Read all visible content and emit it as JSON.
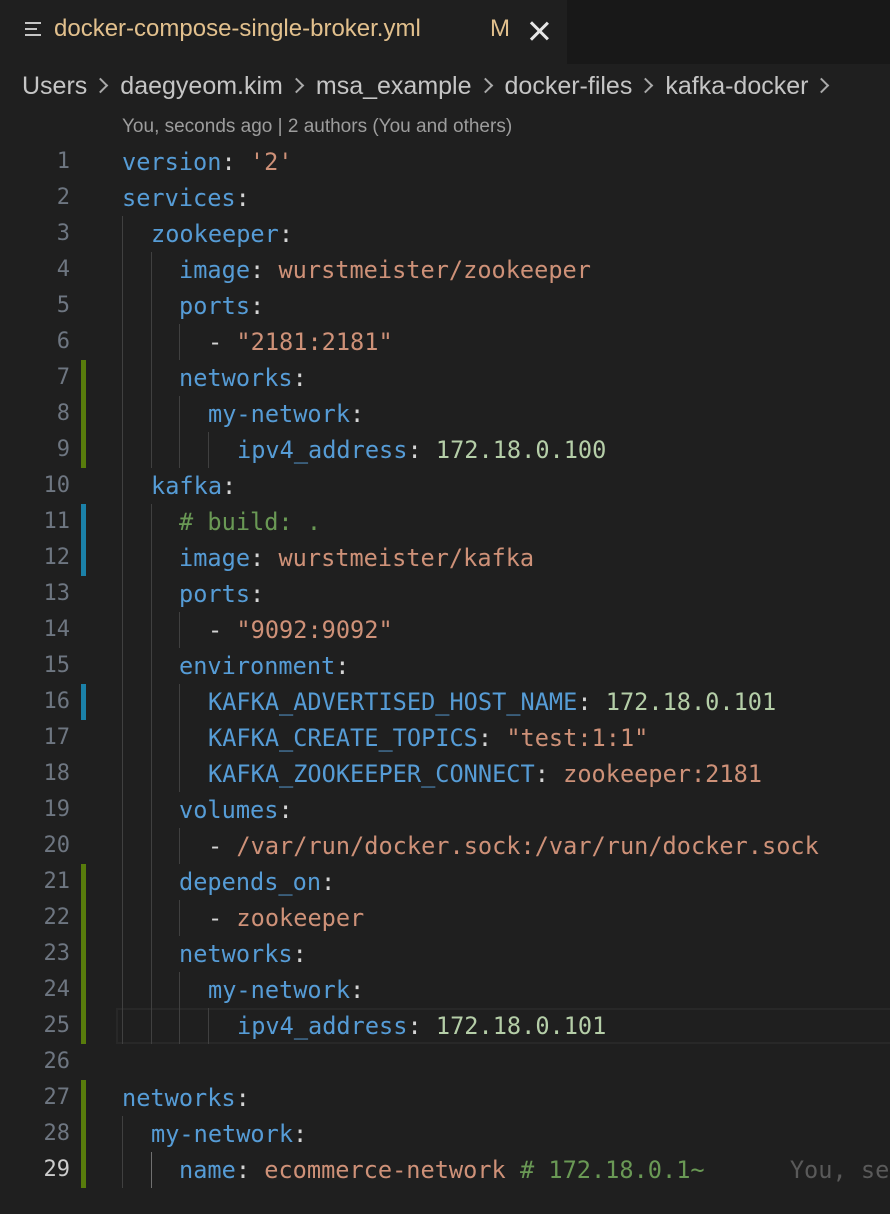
{
  "tab": {
    "file_name": "docker-compose-single-broker.yml",
    "badge": "M",
    "icon": "file-lines-icon"
  },
  "breadcrumb": [
    "Users",
    "daegyeom.kim",
    "msa_example",
    "docker-files",
    "kafka-docker"
  ],
  "blame": "You, seconds ago | 2 authors (You and others)",
  "lines": [
    {
      "n": "1",
      "indent": 0,
      "tokens": [
        {
          "t": "k",
          "v": "version"
        },
        {
          "t": "p",
          "v": ": "
        },
        {
          "t": "s",
          "v": "'2'"
        }
      ]
    },
    {
      "n": "2",
      "indent": 0,
      "tokens": [
        {
          "t": "k",
          "v": "services"
        },
        {
          "t": "p",
          "v": ":"
        }
      ]
    },
    {
      "n": "3",
      "indent": 1,
      "tokens": [
        {
          "t": "k",
          "v": "zookeeper"
        },
        {
          "t": "p",
          "v": ":"
        }
      ]
    },
    {
      "n": "4",
      "indent": 2,
      "tokens": [
        {
          "t": "k",
          "v": "image"
        },
        {
          "t": "p",
          "v": ": "
        },
        {
          "t": "s",
          "v": "wurstmeister/zookeeper"
        }
      ]
    },
    {
      "n": "5",
      "indent": 2,
      "tokens": [
        {
          "t": "k",
          "v": "ports"
        },
        {
          "t": "p",
          "v": ":"
        }
      ]
    },
    {
      "n": "6",
      "indent": 3,
      "tokens": [
        {
          "t": "p",
          "v": "- "
        },
        {
          "t": "s",
          "v": "\"2181:2181\""
        }
      ]
    },
    {
      "n": "7",
      "indent": 2,
      "tokens": [
        {
          "t": "k",
          "v": "networks"
        },
        {
          "t": "p",
          "v": ":"
        }
      ]
    },
    {
      "n": "8",
      "indent": 3,
      "tokens": [
        {
          "t": "k",
          "v": "my-network"
        },
        {
          "t": "p",
          "v": ":"
        }
      ]
    },
    {
      "n": "9",
      "indent": 4,
      "tokens": [
        {
          "t": "k",
          "v": "ipv4_address"
        },
        {
          "t": "p",
          "v": ": "
        },
        {
          "t": "n",
          "v": "172.18.0.100"
        }
      ]
    },
    {
      "n": "10",
      "indent": 1,
      "tokens": [
        {
          "t": "k",
          "v": "kafka"
        },
        {
          "t": "p",
          "v": ":"
        }
      ]
    },
    {
      "n": "11",
      "indent": 2,
      "tokens": [
        {
          "t": "c",
          "v": "# build: ."
        }
      ]
    },
    {
      "n": "12",
      "indent": 2,
      "tokens": [
        {
          "t": "k",
          "v": "image"
        },
        {
          "t": "p",
          "v": ": "
        },
        {
          "t": "s",
          "v": "wurstmeister/kafka"
        }
      ]
    },
    {
      "n": "13",
      "indent": 2,
      "tokens": [
        {
          "t": "k",
          "v": "ports"
        },
        {
          "t": "p",
          "v": ":"
        }
      ]
    },
    {
      "n": "14",
      "indent": 3,
      "tokens": [
        {
          "t": "p",
          "v": "- "
        },
        {
          "t": "s",
          "v": "\"9092:9092\""
        }
      ]
    },
    {
      "n": "15",
      "indent": 2,
      "tokens": [
        {
          "t": "k",
          "v": "environment"
        },
        {
          "t": "p",
          "v": ":"
        }
      ]
    },
    {
      "n": "16",
      "indent": 3,
      "tokens": [
        {
          "t": "k",
          "v": "KAFKA_ADVERTISED_HOST_NAME"
        },
        {
          "t": "p",
          "v": ": "
        },
        {
          "t": "n",
          "v": "172.18.0.101"
        }
      ]
    },
    {
      "n": "17",
      "indent": 3,
      "tokens": [
        {
          "t": "k",
          "v": "KAFKA_CREATE_TOPICS"
        },
        {
          "t": "p",
          "v": ": "
        },
        {
          "t": "s",
          "v": "\"test:1:1\""
        }
      ]
    },
    {
      "n": "18",
      "indent": 3,
      "tokens": [
        {
          "t": "k",
          "v": "KAFKA_ZOOKEEPER_CONNECT"
        },
        {
          "t": "p",
          "v": ": "
        },
        {
          "t": "s",
          "v": "zookeeper:2181"
        }
      ]
    },
    {
      "n": "19",
      "indent": 2,
      "tokens": [
        {
          "t": "k",
          "v": "volumes"
        },
        {
          "t": "p",
          "v": ":"
        }
      ]
    },
    {
      "n": "20",
      "indent": 3,
      "tokens": [
        {
          "t": "p",
          "v": "- "
        },
        {
          "t": "s",
          "v": "/var/run/docker.sock:/var/run/docker.sock"
        }
      ]
    },
    {
      "n": "21",
      "indent": 2,
      "tokens": [
        {
          "t": "k",
          "v": "depends_on"
        },
        {
          "t": "p",
          "v": ":"
        }
      ]
    },
    {
      "n": "22",
      "indent": 3,
      "tokens": [
        {
          "t": "p",
          "v": "- "
        },
        {
          "t": "s",
          "v": "zookeeper"
        }
      ]
    },
    {
      "n": "23",
      "indent": 2,
      "tokens": [
        {
          "t": "k",
          "v": "networks"
        },
        {
          "t": "p",
          "v": ":"
        }
      ]
    },
    {
      "n": "24",
      "indent": 3,
      "tokens": [
        {
          "t": "k",
          "v": "my-network"
        },
        {
          "t": "p",
          "v": ":"
        }
      ]
    },
    {
      "n": "25",
      "indent": 4,
      "tokens": [
        {
          "t": "k",
          "v": "ipv4_address"
        },
        {
          "t": "p",
          "v": ": "
        },
        {
          "t": "n",
          "v": "172.18.0.101"
        }
      ]
    },
    {
      "n": "26",
      "indent": 0,
      "tokens": []
    },
    {
      "n": "27",
      "indent": 0,
      "tokens": [
        {
          "t": "k",
          "v": "networks"
        },
        {
          "t": "p",
          "v": ":"
        }
      ]
    },
    {
      "n": "28",
      "indent": 1,
      "tokens": [
        {
          "t": "k",
          "v": "my-network"
        },
        {
          "t": "p",
          "v": ":"
        }
      ]
    },
    {
      "n": "29",
      "indent": 2,
      "tokens": [
        {
          "t": "k",
          "v": "name"
        },
        {
          "t": "p",
          "v": ": "
        },
        {
          "t": "s",
          "v": "ecommerce-network"
        },
        {
          "t": "p",
          "v": " "
        },
        {
          "t": "c",
          "v": "# 172.18.0.1~"
        },
        {
          "t": "ghost",
          "v": "      You, se"
        }
      ]
    }
  ],
  "active_line": "29",
  "gutter_marks": {
    "added": [
      "7",
      "8",
      "9",
      "21",
      "22",
      "23",
      "24",
      "25",
      "27",
      "28",
      "29"
    ],
    "modified": [
      "11",
      "12",
      "16"
    ]
  },
  "colors": {
    "keyword": "#569cd6",
    "string": "#ce9178",
    "number": "#b5cea8",
    "comment": "#6a9955",
    "added": "#587c0c",
    "modified": "#1b81a8",
    "tab_label": "#e2c08d"
  }
}
